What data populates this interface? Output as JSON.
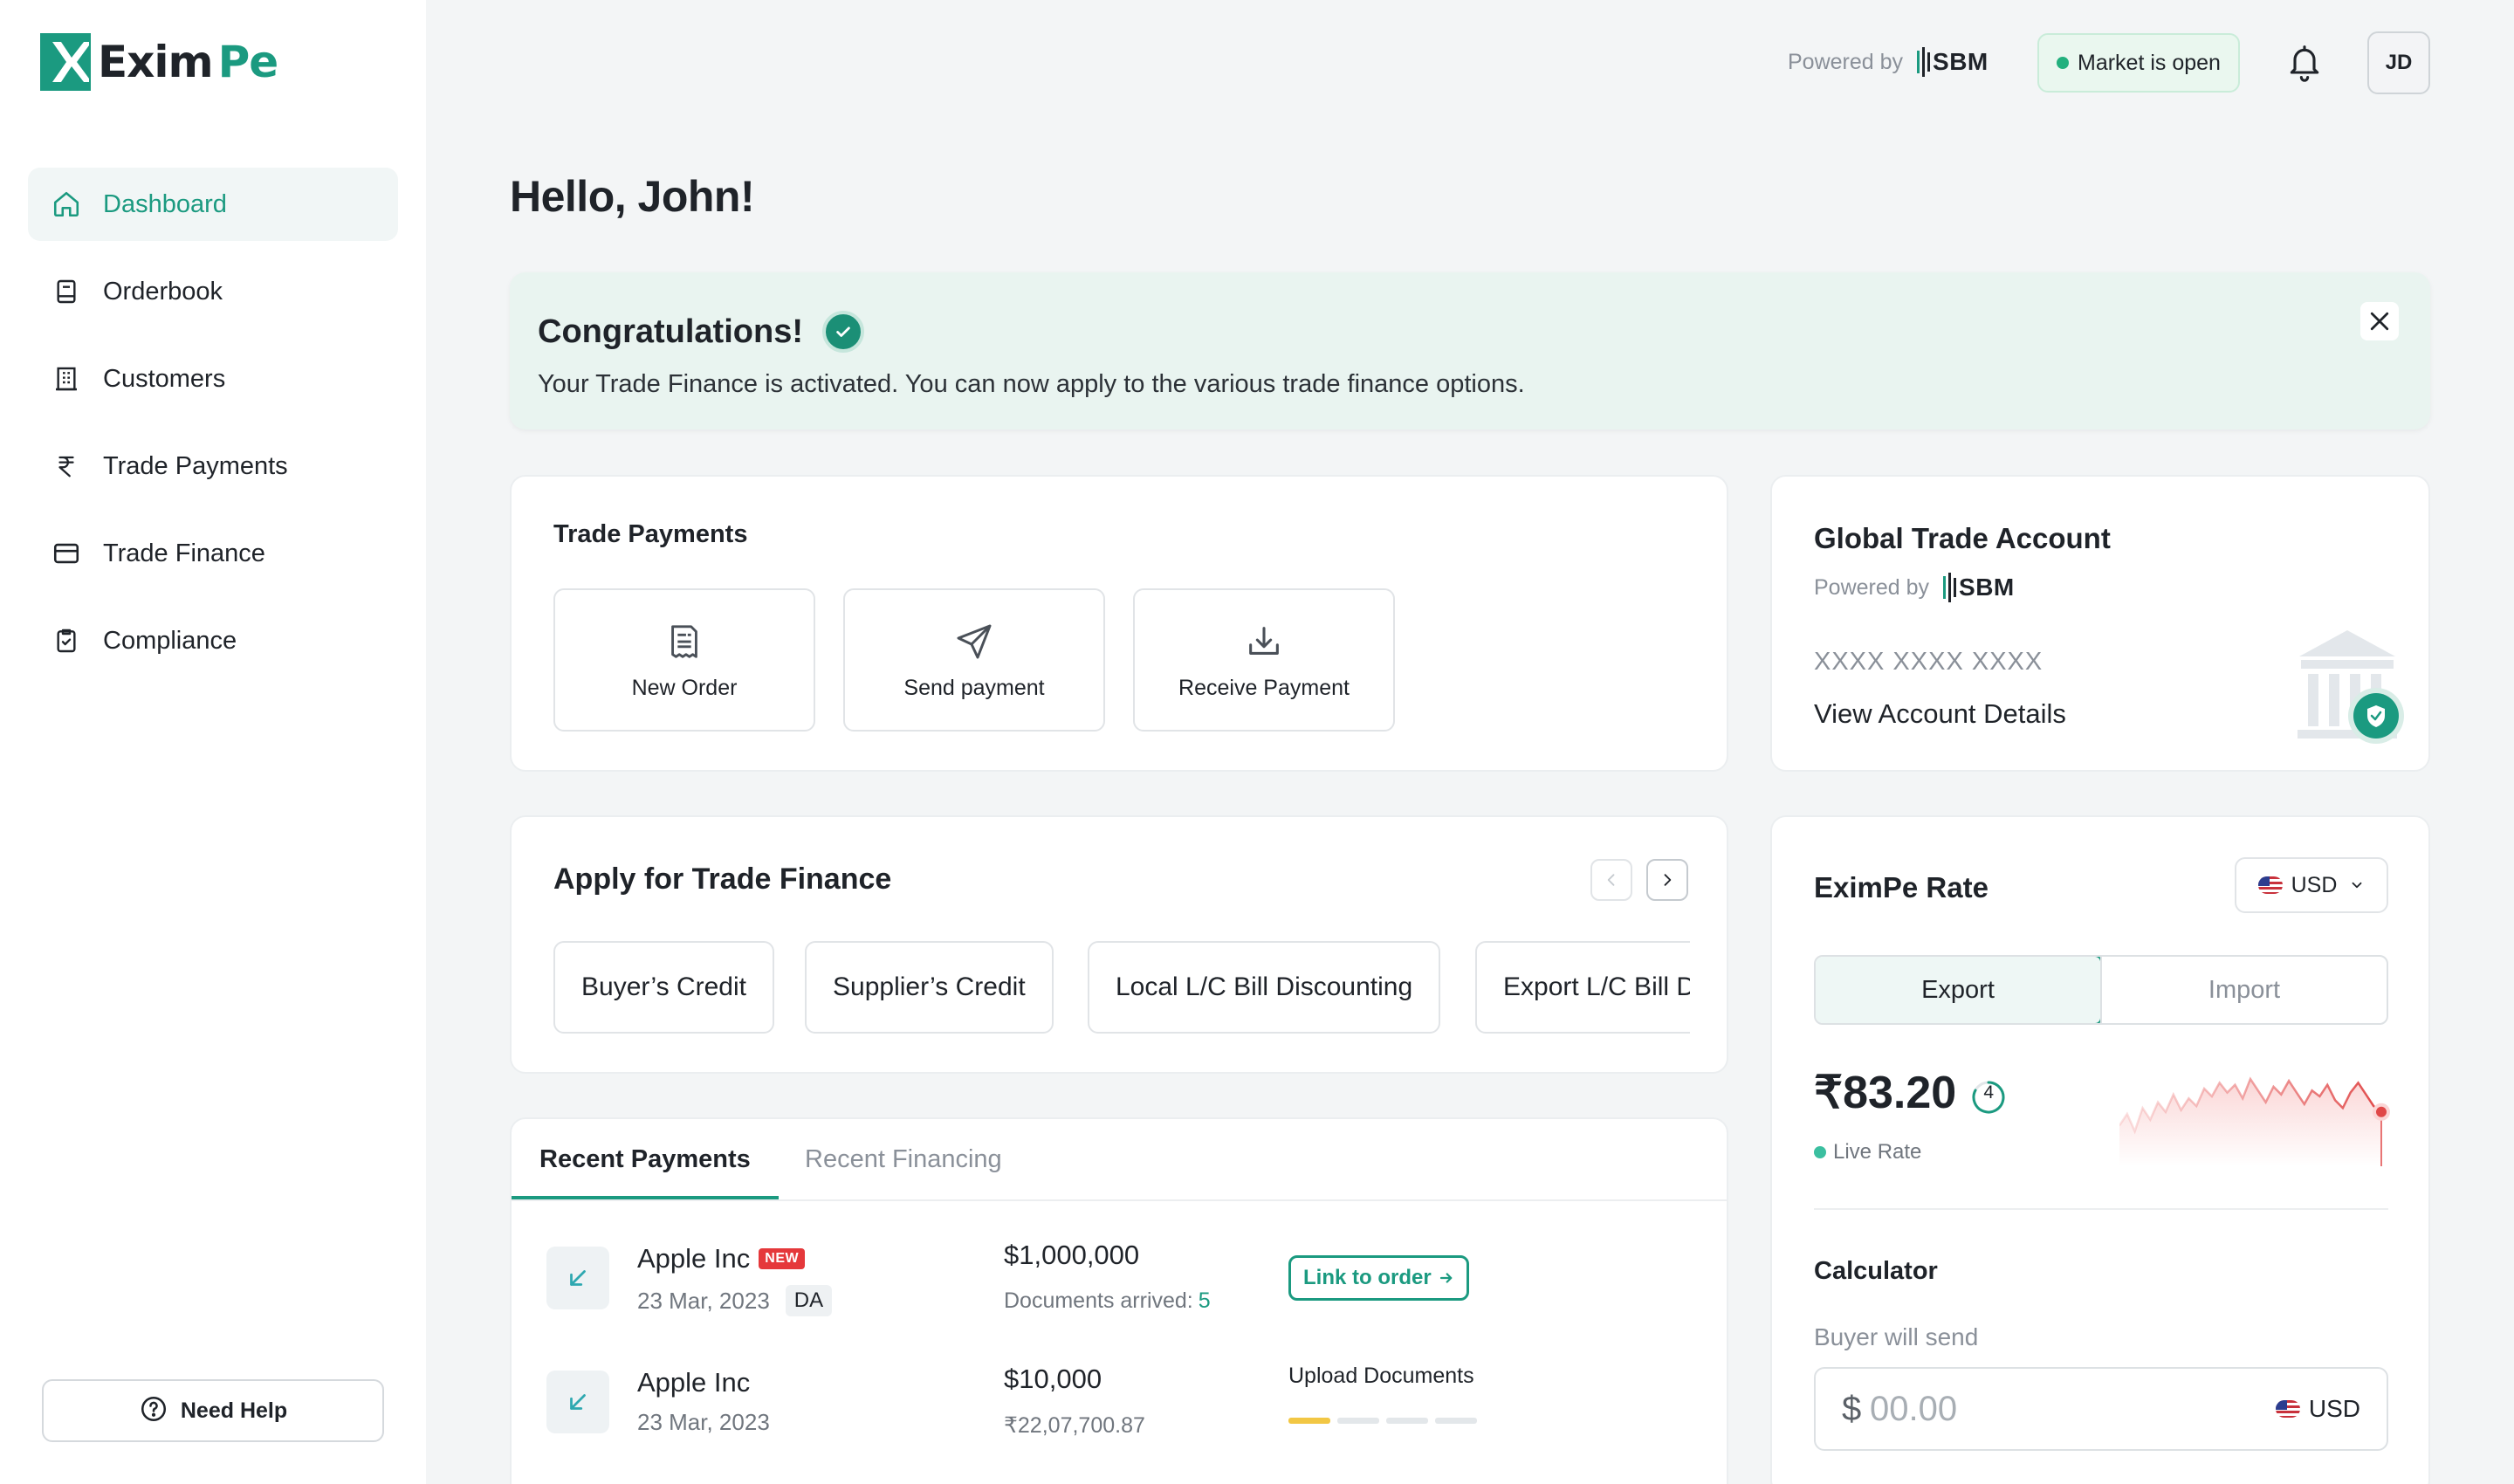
{
  "brand": {
    "name_part1": "Exim",
    "name_part2": "Pe"
  },
  "sidebar": {
    "items": [
      {
        "label": "Dashboard",
        "icon": "home-icon",
        "active": true
      },
      {
        "label": "Orderbook",
        "icon": "book-icon"
      },
      {
        "label": "Customers",
        "icon": "building-icon"
      },
      {
        "label": "Trade Payments",
        "icon": "rupee-icon"
      },
      {
        "label": "Trade Finance",
        "icon": "card-icon"
      },
      {
        "label": "Compliance",
        "icon": "clipboard-check-icon"
      }
    ],
    "help_label": "Need Help"
  },
  "topbar": {
    "powered_by": "Powered by",
    "partner": "SBM",
    "market_status": "Market is open",
    "avatar_initials": "JD"
  },
  "greeting": "Hello, John!",
  "banner": {
    "title": "Congratulations!",
    "message": "Your Trade Finance is activated. You can now apply to the various trade finance options."
  },
  "trade_payments": {
    "title": "Trade Payments",
    "actions": [
      {
        "label": "New Order",
        "icon": "receipt-icon"
      },
      {
        "label": "Send payment",
        "icon": "send-icon"
      },
      {
        "label": "Receive Payment",
        "icon": "download-icon"
      }
    ]
  },
  "global_account": {
    "title": "Global Trade Account",
    "powered_by": "Powered by",
    "partner": "SBM",
    "account_number": "XXXX XXXX XXXX",
    "view_details": "View Account Details"
  },
  "apply_finance": {
    "title": "Apply for Trade Finance",
    "options": [
      "Buyer’s Credit",
      "Supplier’s Credit",
      "Local L/C Bill Discounting",
      "Export L/C Bill Discounting"
    ]
  },
  "recent": {
    "tabs": [
      "Recent Payments",
      "Recent Financing"
    ],
    "rows": [
      {
        "name": "Apple Inc",
        "badge": "NEW",
        "date": "23 Mar, 2023",
        "tag": "DA",
        "amount": "$1,000,000",
        "sub_label": "Documents arrived:",
        "sub_value": "5",
        "action": "Link to order"
      },
      {
        "name": "Apple Inc",
        "date": "23 Mar, 2023",
        "amount": "$10,000",
        "sub_label": "₹22,07,700.87",
        "action": "Upload Documents",
        "progress_steps": 4,
        "progress_done": 1
      }
    ]
  },
  "rate": {
    "title": "EximPe Rate",
    "currency": "USD",
    "modes": [
      "Export",
      "Import"
    ],
    "active_mode": "Export",
    "value": "₹83.20",
    "timer": "4",
    "live_label": "Live Rate",
    "sparkline": [
      5.2,
      5.8,
      4.9,
      6.1,
      5.5,
      6.4,
      5.9,
      6.8,
      6.0,
      6.6,
      6.2,
      7.1,
      6.7,
      7.4,
      6.9,
      7.3,
      6.6,
      7.6,
      7.0,
      6.4,
      7.2,
      6.8,
      7.5,
      6.9,
      6.3,
      7.0,
      6.7,
      7.3,
      6.5,
      6.1,
      6.9,
      7.4,
      6.8,
      6.2,
      5.9
    ],
    "calculator": {
      "title": "Calculator",
      "label": "Buyer will send",
      "prefix": "$",
      "placeholder": "00.00",
      "currency": "USD"
    }
  }
}
